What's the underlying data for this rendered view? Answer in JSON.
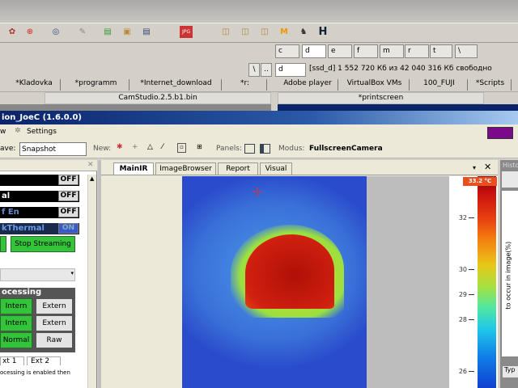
{
  "drives": [
    "c",
    "d",
    "e",
    "f",
    "m",
    "r",
    "t",
    "\\"
  ],
  "drive_select": "d",
  "drive_info": "[ssd_d]  1 552 720 Кб из 42 040 316 Кб свободно",
  "nav": [
    "\\",
    ".."
  ],
  "left_tabs": [
    "*Kladovka",
    "*programm",
    "*Internet_download",
    "*r:"
  ],
  "left_path": "CamStudio.2.5.b1.bin",
  "right_tabs": [
    "Adobe player",
    "VirtualBox VMs",
    "100_FUJI",
    "*Scripts"
  ],
  "right_path": "*printscreen",
  "app_title": "ion_JoeC (1.6.0.0)",
  "menu": {
    "view": "w",
    "settings": "Settings"
  },
  "toolbar": {
    "save_label": "ave:",
    "save_value": "Snapshot",
    "new_label": "New:",
    "panels_label": "Panels:",
    "modus_label": "Modus:",
    "fullscreen": "Fullscreen",
    "camera": "Camera"
  },
  "left_panel": {
    "toggles": [
      {
        "label": "",
        "state": "OFF"
      },
      {
        "label": "al",
        "state": "OFF"
      },
      {
        "label": "f En",
        "state": "OFF"
      },
      {
        "label": "kThermal",
        "state": "ON"
      }
    ],
    "stop_streaming": "Stop Streaming",
    "processing_title": "ocessing",
    "rows": [
      [
        "Intern",
        "Extern"
      ],
      [
        "Intern",
        "Extern"
      ],
      [
        "Normal",
        "Raw"
      ]
    ],
    "ext_tabs": [
      "xt 1",
      "Ext 2"
    ],
    "note": "ocessing is enabled then"
  },
  "doc_tabs": [
    "MainIR",
    "ImageBrowser",
    "Report",
    "Visual"
  ],
  "colorbar": {
    "max_label": "33.2 °C",
    "ticks": [
      "32",
      "30",
      "29",
      "28",
      "26"
    ]
  },
  "histogram": {
    "title": "Histo",
    "ylabel": "to occur in image(%)",
    "bottom_label": "Typ"
  }
}
